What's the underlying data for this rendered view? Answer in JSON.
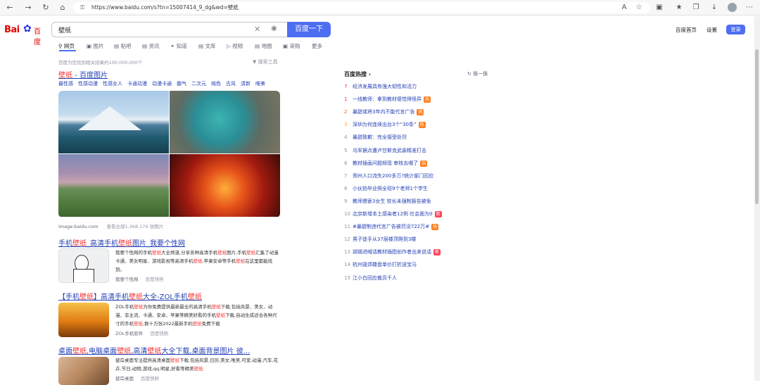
{
  "browser": {
    "url": "https://www.baidu.com/s?tn=15007414_9_dg&wd=壁纸",
    "toolbar_icons": [
      "reader-icon",
      "favorite-add-icon",
      "extensions-icon",
      "favorites-icon",
      "collections-icon",
      "downloads-icon",
      "profile-icon",
      "more-icon"
    ]
  },
  "header": {
    "logo_text": "Bai",
    "logo_text2": "百度",
    "search_value": "壁纸",
    "search_button": "百度一下",
    "links": [
      "百度首页",
      "设置"
    ],
    "login": "登录"
  },
  "tabs": [
    {
      "label": "网页",
      "icon": "search-icon"
    },
    {
      "label": "图片",
      "icon": "image-icon"
    },
    {
      "label": "贴吧",
      "icon": "tieba-icon"
    },
    {
      "label": "资讯",
      "icon": "news-icon"
    },
    {
      "label": "知道",
      "icon": "question-icon"
    },
    {
      "label": "文库",
      "icon": "doc-icon"
    },
    {
      "label": "视频",
      "icon": "video-icon"
    },
    {
      "label": "地图",
      "icon": "map-icon"
    },
    {
      "label": "采购",
      "icon": "shop-icon"
    },
    {
      "label": "更多",
      "icon": ""
    }
  ],
  "results_count": "百度为您找到相关结果约100,000,000个",
  "search_tools": "搜索工具",
  "image_result": {
    "title_em": "壁纸",
    "title_rest": " - 百度图片",
    "tags": [
      "最性感",
      "性感动漫",
      "性感女人",
      "卡通动漫",
      "动漫卡通",
      "霸气",
      "二次元",
      "纯色",
      "古风",
      "清新",
      "唯美"
    ],
    "source": "image.baidu.com",
    "more": "查看全部1,368,176 张图片"
  },
  "results": [
    {
      "title_a": "手机",
      "title_b": "壁纸",
      "title_c": "_高清手机",
      "title_d": "壁纸",
      "title_e": "图片_我要个性网",
      "snippet": [
        {
          "t": "我要个性网的手机"
        },
        {
          "t": "壁纸",
          "em": true
        },
        {
          "t": "大全频道,分享各种高清手机"
        },
        {
          "t": "壁纸",
          "em": true
        },
        {
          "t": "图片,手机"
        },
        {
          "t": "壁纸",
          "em": true
        },
        {
          "t": "汇集了动漫卡通、美女明星、游戏影视等高清手机"
        },
        {
          "t": "壁纸",
          "em": true
        },
        {
          "t": ",苹果安卓等手机"
        },
        {
          "t": "壁纸",
          "em": true
        },
        {
          "t": "在这里都能找到。"
        }
      ],
      "source": "我要个性网",
      "cache": "百度快照"
    },
    {
      "title_a": "【手机",
      "title_b": "壁纸",
      "title_c": "】高清手机",
      "title_d": "壁纸",
      "title_e": "大全-ZOL手机",
      "title_f": "壁纸",
      "snippet": [
        {
          "t": "ZOL手机"
        },
        {
          "t": "壁纸",
          "em": true
        },
        {
          "t": "为你免费提供最新最全的高清手机"
        },
        {
          "t": "壁纸",
          "em": true
        },
        {
          "t": "下载,包括风景、美女、动漫、非主流、卡通、安卓、苹果等精美好看的手机"
        },
        {
          "t": "壁纸",
          "em": true
        },
        {
          "t": "下载,自动生成适合各种尺寸的手机"
        },
        {
          "t": "壁纸",
          "em": true
        },
        {
          "t": ",数十万张2022最新手机"
        },
        {
          "t": "壁纸",
          "em": true
        },
        {
          "t": "免费下载"
        }
      ],
      "source": "ZOL手机软件",
      "cache": "百度快照"
    },
    {
      "title_a": "桌面",
      "title_b": "壁纸",
      "title_c": ",电脑桌面",
      "title_d": "壁纸",
      "title_e": ",高清",
      "title_f": "壁纸",
      "title_g": "大全下载,桌面背景图片 彼...",
      "snippet": [
        {
          "t": "彼岸桌面专注提供高清桌面"
        },
        {
          "t": "壁纸",
          "em": true
        },
        {
          "t": "下载,包括风景,日历,美女,唯美,可爱,动漫,汽车,花卉,节日,动物,游戏,qq,明星,好看等精美"
        },
        {
          "t": "壁纸",
          "em": true
        }
      ],
      "source": "彼岸桌面",
      "cache": "百度快照"
    }
  ],
  "hot": {
    "title": "百度热搜",
    "refresh": "换一换",
    "items": [
      {
        "rank": "↑",
        "text": "经济发展具有强大韧性和活力",
        "badge": ""
      },
      {
        "rank": "1",
        "text": "一线教师：拿到教材便觉得怪异",
        "badge": "热"
      },
      {
        "rank": "2",
        "text": "暴甜或将3年内不能代言广告",
        "badge": "热"
      },
      {
        "rank": "3",
        "text": "深圳为何连续出台3个“30条”",
        "badge": "热"
      },
      {
        "rank": "4",
        "text": "暴甜致歉：完全接受处罚",
        "badge": ""
      },
      {
        "rank": "5",
        "text": "乌军据点遭卢甘斯克武装精准打击",
        "badge": ""
      },
      {
        "rank": "6",
        "text": "教材插画问题频现 审核去哪了",
        "badge": "热"
      },
      {
        "rank": "7",
        "text": "郑州人口流失200多万?统计部门回应",
        "badge": ""
      },
      {
        "rank": "8",
        "text": "小伙拍毕业照全班9个老师1个学生",
        "badge": ""
      },
      {
        "rank": "9",
        "text": "教师猥亵3女生 校长未强制报告被免",
        "badge": ""
      },
      {
        "rank": "10",
        "text": "北京新增本土感染者12例 社会面为0",
        "badge": "新"
      },
      {
        "rank": "11",
        "text": "#暴甜制违代言广告被罚没722万#",
        "badge": "热"
      },
      {
        "rank": "12",
        "text": "男子徒手从37层楼顶爬到3楼",
        "badge": ""
      },
      {
        "rank": "13",
        "text": "胡锡进喊话教材插图创作者出来说话",
        "badge": "新"
      },
      {
        "rank": "14",
        "text": "杭州毁郊楼盘单价打折送宝马",
        "badge": ""
      },
      {
        "rank": "15",
        "text": "江小白回应裁员千人",
        "badge": ""
      }
    ]
  }
}
